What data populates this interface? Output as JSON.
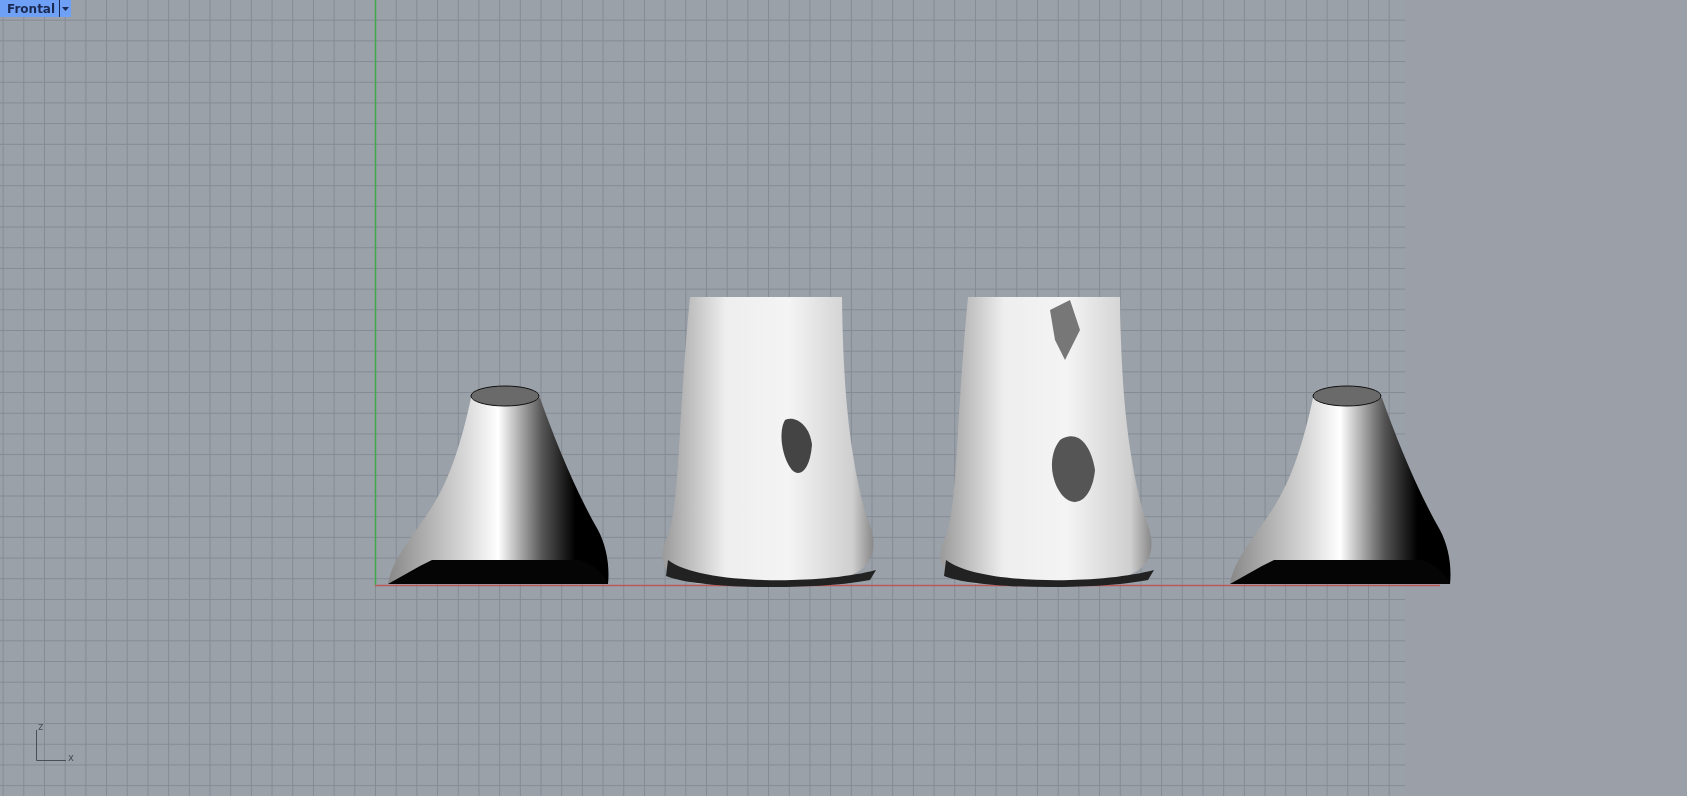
{
  "viewport": {
    "title": "Frontal",
    "axis_labels": {
      "vertical": "z",
      "horizontal": "x"
    }
  }
}
